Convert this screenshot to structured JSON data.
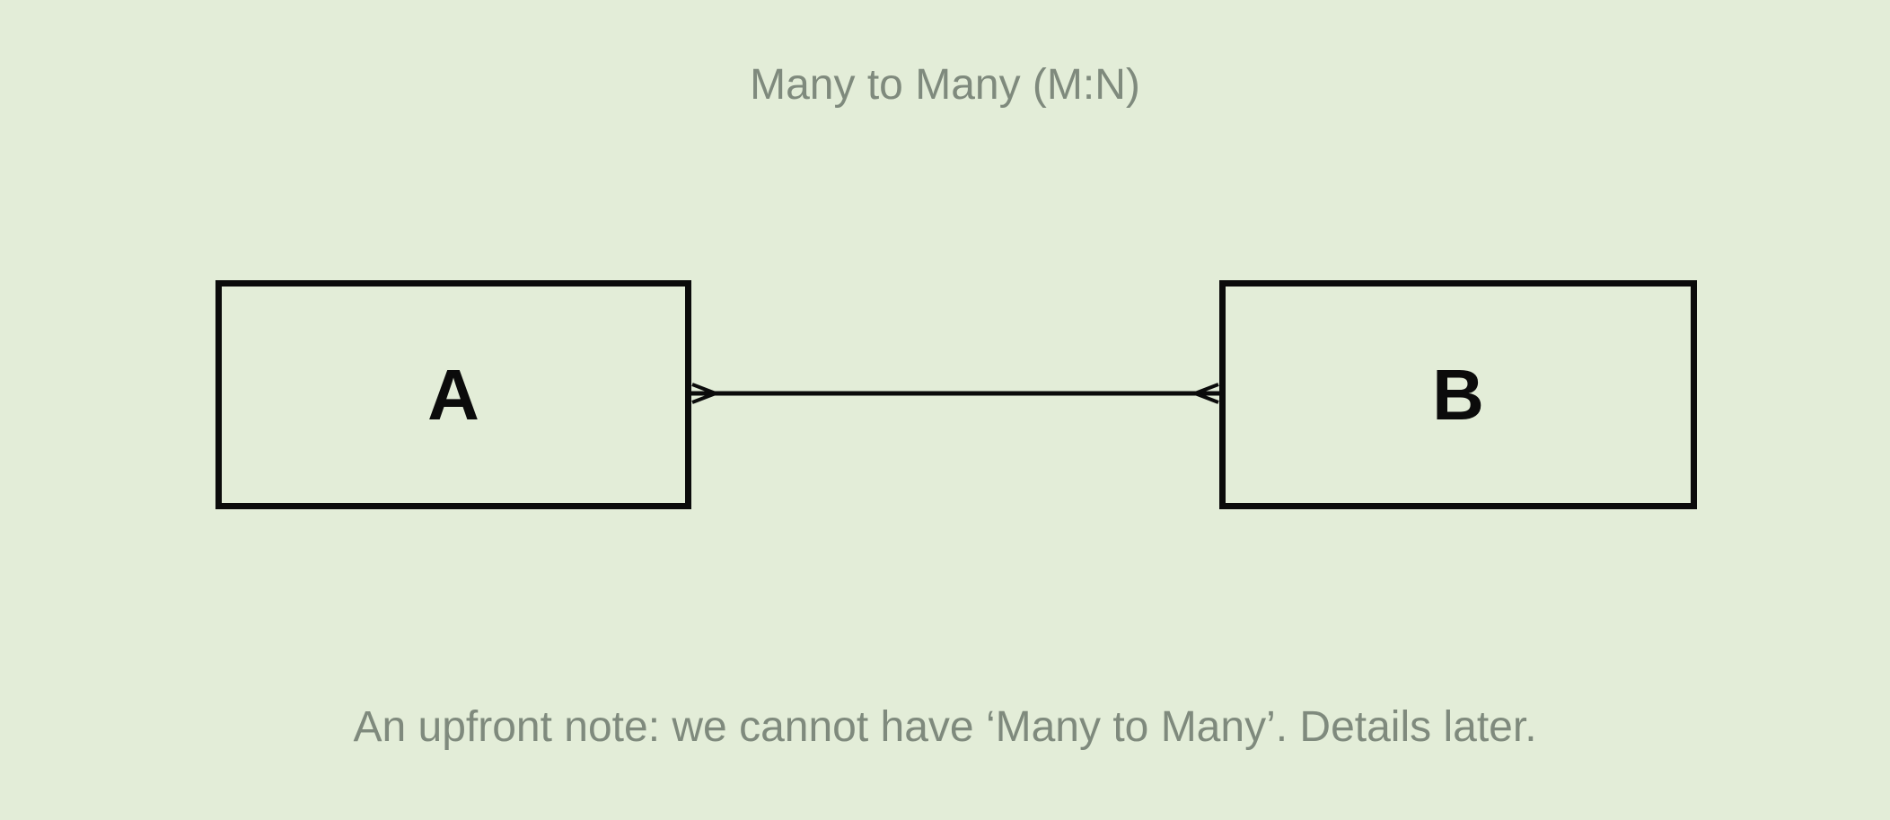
{
  "title": "Many to Many (M:N)",
  "entities": {
    "a": {
      "label": "A"
    },
    "b": {
      "label": "B"
    }
  },
  "relationship": {
    "cardinality_a": "many",
    "cardinality_b": "many"
  },
  "note": "An upfront note: we cannot have ‘Many to Many’. Details later.",
  "colors": {
    "background": "#e3edd8",
    "text_muted": "#7f8a7d",
    "stroke": "#0b0b0b"
  }
}
